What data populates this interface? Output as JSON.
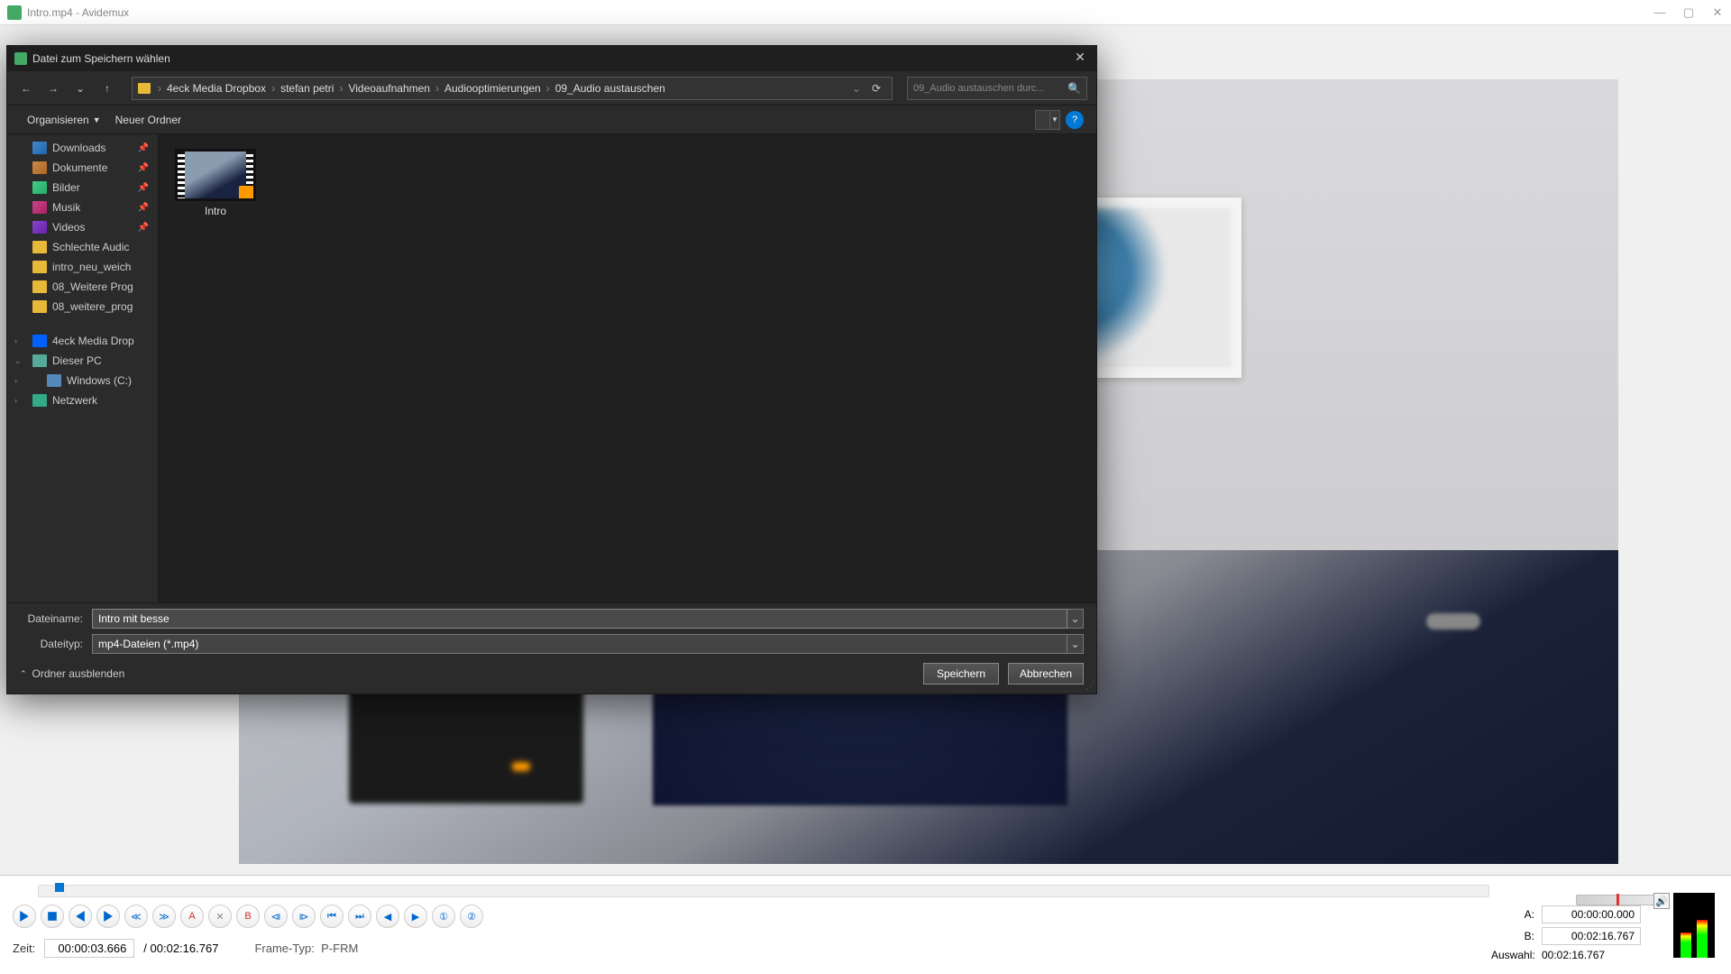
{
  "app": {
    "title": "Intro.mp4 - Avidemux"
  },
  "window_buttons": {
    "min": "—",
    "max": "▢",
    "close": "✕"
  },
  "dialog": {
    "title": "Datei zum Speichern wählen",
    "close": "✕",
    "nav": {
      "back": "←",
      "forward": "→",
      "recent": "⌄",
      "up": "↑",
      "refresh": "⟳"
    },
    "breadcrumb": [
      "4eck Media Dropbox",
      "stefan petri",
      "Videoaufnahmen",
      "Audiooptimierungen",
      "09_Audio austauschen"
    ],
    "search_placeholder": "09_Audio austauschen durc...",
    "toolbar": {
      "organize": "Organisieren",
      "new_folder": "Neuer Ordner",
      "help": "?"
    },
    "sidebar": {
      "quick": [
        {
          "label": "Downloads",
          "icon": "dl",
          "pinned": true
        },
        {
          "label": "Dokumente",
          "icon": "doc",
          "pinned": true
        },
        {
          "label": "Bilder",
          "icon": "pic",
          "pinned": true
        },
        {
          "label": "Musik",
          "icon": "mus",
          "pinned": true
        },
        {
          "label": "Videos",
          "icon": "vid",
          "pinned": true
        },
        {
          "label": "Schlechte Audic",
          "icon": "folder",
          "pinned": false
        },
        {
          "label": "intro_neu_weich",
          "icon": "folder",
          "pinned": false
        },
        {
          "label": "08_Weitere Prog",
          "icon": "folder",
          "pinned": false
        },
        {
          "label": "08_weitere_prog",
          "icon": "folder",
          "pinned": false
        }
      ],
      "locations": [
        {
          "label": "4eck Media Drop",
          "icon": "dropbox",
          "expandable": true
        },
        {
          "label": "Dieser PC",
          "icon": "pc",
          "expandable": true,
          "expanded": true
        },
        {
          "label": "Windows (C:)",
          "icon": "drive",
          "expandable": true,
          "indent": true
        },
        {
          "label": "Netzwerk",
          "icon": "net",
          "expandable": true
        }
      ]
    },
    "files": [
      {
        "name": "Intro"
      }
    ],
    "footer": {
      "filename_label": "Dateiname:",
      "filename_value": "Intro mit besse",
      "filetype_label": "Dateityp:",
      "filetype_value": "mp4-Dateien (*.mp4)",
      "hide_folders": "Ordner ausblenden",
      "save": "Speichern",
      "cancel": "Abbrechen"
    }
  },
  "playback": {
    "time_label": "Zeit:",
    "time_value": "00:00:03.666",
    "duration": "/ 00:02:16.767",
    "frame_label": "Frame-Typ:",
    "frame_value": "P-FRM"
  },
  "ab": {
    "a_label": "A:",
    "a_value": "00:00:00.000",
    "b_label": "B:",
    "b_value": "00:02:16.767",
    "sel_label": "Auswahl:",
    "sel_value": "00:02:16.767"
  }
}
